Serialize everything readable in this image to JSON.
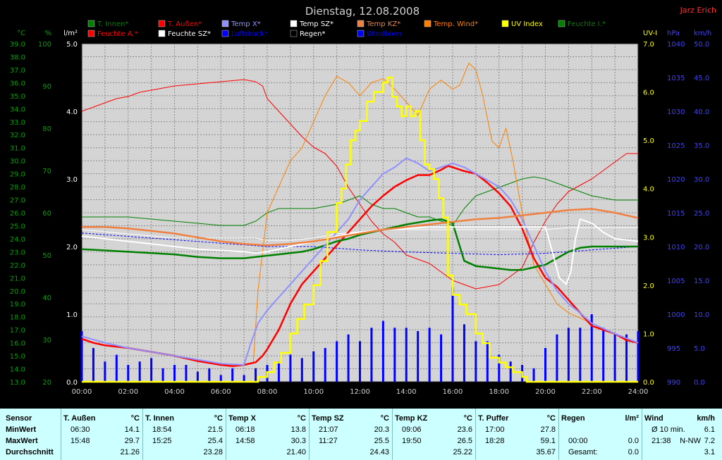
{
  "title": "Dienstag, 12.08.2008",
  "author": "Jarz Erich",
  "colors": {
    "background": "#000000",
    "plot": "#d4d4d4",
    "grid": "#808080",
    "stats_bg": "#ccffff"
  },
  "legend": [
    {
      "name": "T. Innen*",
      "color": "#008000"
    },
    {
      "name": "T. Außen*",
      "color": "#ff0000"
    },
    {
      "name": "Temp X*",
      "color": "#9090ff"
    },
    {
      "name": "Temp SZ*",
      "color": "#ffffff"
    },
    {
      "name": "Temp KZ*",
      "color": "#f08040"
    },
    {
      "name": "Temp. Wind*",
      "color": "#ff8000"
    },
    {
      "name": "UV Index",
      "color": "#ffff00"
    },
    {
      "name": "Feuchte I.*",
      "color": "#008000"
    },
    {
      "name": "Feuchte A.*",
      "color": "#ff0000"
    },
    {
      "name": "Feuchte SZ*",
      "color": "#ffffff"
    },
    {
      "name": "Luftdruck*",
      "color": "#0000ff"
    },
    {
      "name": "Regen*",
      "color": "#000000"
    },
    {
      "name": "Windböen",
      "color": "#0000ff"
    }
  ],
  "axes": {
    "temp": {
      "unit": "°C",
      "min": 13,
      "max": 39,
      "color": "#00a000"
    },
    "hum": {
      "unit": "%",
      "min": 20,
      "max": 100,
      "color": "#00a000"
    },
    "rain": {
      "unit": "l/m²",
      "min": 0,
      "max": 5,
      "color": "#ffffff"
    },
    "uv": {
      "unit": "UV-I",
      "min": 0,
      "max": 7,
      "color": "#ffff00"
    },
    "press": {
      "unit": "hPa",
      "min": 990,
      "max": 1040,
      "color": "#4040ff"
    },
    "wind": {
      "unit": "km/h",
      "min": 0,
      "max": 50,
      "color": "#4040ff"
    }
  },
  "x_ticks": [
    "00:00",
    "02:00",
    "04:00",
    "06:00",
    "08:00",
    "10:00",
    "12:00",
    "14:00",
    "16:00",
    "18:00",
    "20:00",
    "22:00",
    "24:00"
  ],
  "chart_data": {
    "type": "line",
    "title": "Dienstag, 12.08.2008",
    "x_unit": "hours",
    "xlim": [
      0,
      24
    ],
    "series": [
      {
        "name": "T. Außen*",
        "axis": "temp",
        "color": "#ff0000",
        "width": 2.5,
        "x": [
          0,
          0.5,
          1,
          2,
          3,
          4,
          5,
          6,
          6.5,
          7,
          7.5,
          7.8,
          8,
          8.5,
          9,
          9.5,
          10,
          10.5,
          11,
          11.5,
          12,
          12.5,
          13,
          13.5,
          14,
          14.5,
          15,
          15.5,
          15.8,
          16,
          16.5,
          17,
          17.5,
          18,
          18.5,
          19,
          19.5,
          20,
          20.5,
          21,
          21.5,
          22,
          22.5,
          23,
          23.5,
          24
        ],
        "y": [
          16.3,
          16,
          15.8,
          15.6,
          15.3,
          15,
          14.6,
          14.3,
          14.2,
          14.3,
          14.5,
          15,
          15.5,
          17,
          19,
          20.5,
          21.5,
          22.5,
          23.5,
          24.5,
          25.5,
          26.5,
          27.3,
          28,
          28.5,
          28.9,
          28.9,
          29.3,
          29.6,
          29.5,
          29.2,
          29,
          28.3,
          27.5,
          26.5,
          24.8,
          22.5,
          21,
          20.3,
          19.3,
          18.3,
          17.3,
          17,
          16.7,
          16.2,
          16
        ]
      },
      {
        "name": "T. Innen*",
        "axis": "temp",
        "color": "#008000",
        "width": 2.5,
        "x": [
          0,
          1,
          2,
          3,
          4,
          5,
          6,
          7,
          7.5,
          8,
          8.5,
          9,
          9.5,
          10,
          10.5,
          11,
          11.5,
          12,
          13,
          14,
          15,
          15.5,
          16,
          16.5,
          17,
          17.5,
          18,
          18.5,
          19,
          19.5,
          20,
          20.5,
          21,
          21.5,
          22,
          23,
          24
        ],
        "y": [
          23.2,
          23.1,
          23,
          22.9,
          22.8,
          22.6,
          22.5,
          22.5,
          22.6,
          22.7,
          22.8,
          22.9,
          23,
          23.2,
          23.5,
          23.8,
          24,
          24.3,
          24.7,
          25.1,
          25.4,
          25.5,
          25.2,
          22.3,
          21.9,
          21.8,
          21.7,
          21.6,
          21.6,
          21.8,
          22,
          22.5,
          23,
          23.3,
          23.4,
          23.4,
          23.4
        ]
      },
      {
        "name": "Temp X*",
        "axis": "temp",
        "color": "#9090ff",
        "width": 2,
        "x": [
          0,
          1,
          2,
          3,
          4,
          5,
          6,
          7,
          7.3,
          7.6,
          8,
          8.5,
          9,
          9.5,
          10,
          10.5,
          11,
          11.5,
          12,
          12.5,
          13,
          13.5,
          14,
          14.5,
          15,
          15.5,
          16,
          16.5,
          17,
          17.5,
          18,
          18.5,
          19,
          19.5,
          20,
          20.5,
          21,
          21.5,
          22,
          23,
          24
        ],
        "y": [
          16.5,
          16,
          15.6,
          15.3,
          15,
          14.7,
          14.4,
          14.3,
          16,
          17.5,
          18.5,
          19.5,
          20.5,
          21.5,
          22.5,
          23.5,
          24.5,
          25.5,
          27,
          28,
          29,
          29.5,
          30.2,
          29.8,
          29.2,
          29.5,
          29.8,
          29.5,
          29,
          28.5,
          28,
          27,
          25.5,
          23.5,
          21.5,
          20,
          19,
          18.3,
          17.5,
          16.7,
          16
        ]
      },
      {
        "name": "Temp SZ*",
        "axis": "temp",
        "color": "#ffffff",
        "width": 2,
        "x": [
          0,
          1,
          2,
          3,
          4,
          5,
          6,
          7,
          7.5,
          8,
          8.5,
          9,
          9.5,
          10,
          11,
          12,
          13,
          14,
          15,
          16,
          17,
          18,
          19,
          19.5,
          20,
          20.3,
          20.6,
          20.9,
          21.1,
          21.3,
          21.5,
          22,
          22.5,
          23,
          24
        ],
        "y": [
          24.2,
          24,
          23.8,
          23.6,
          23.4,
          23.2,
          23.1,
          23,
          22.9,
          23,
          23.2,
          23.4,
          23.6,
          23.8,
          24.2,
          24.5,
          24.7,
          24.8,
          24.9,
          24.9,
          24.9,
          24.9,
          24.9,
          24.9,
          24.9,
          23,
          21,
          20.5,
          21.5,
          24,
          25.5,
          25.2,
          24.5,
          24,
          23.8
        ]
      },
      {
        "name": "Temp KZ*",
        "axis": "temp",
        "color": "#f08040",
        "width": 2.5,
        "x": [
          0,
          1,
          2,
          3,
          4,
          5,
          6,
          7,
          8,
          9,
          10,
          11,
          12,
          13,
          14,
          15,
          16,
          17,
          18,
          19,
          20,
          21,
          22,
          23,
          24
        ],
        "y": [
          24.9,
          24.9,
          24.8,
          24.6,
          24.4,
          24.1,
          23.8,
          23.6,
          23.5,
          23.6,
          23.8,
          24.1,
          24.4,
          24.7,
          24.9,
          25.1,
          25.3,
          25.5,
          25.6,
          25.8,
          26,
          26.2,
          26.3,
          26,
          25.6
        ]
      }
    ],
    "other_series": [
      {
        "name": "Feuchte A.*",
        "axis": "hum",
        "color": "#ff0000",
        "width": 1,
        "x": [
          0,
          0.5,
          1,
          1.5,
          2,
          2.5,
          3,
          4,
          5,
          6,
          7,
          7.5,
          7.8,
          8,
          8.5,
          9,
          9.5,
          10,
          10.5,
          11,
          11.5,
          12,
          12.5,
          13,
          13.5,
          14,
          14.5,
          15,
          15.5,
          16,
          16.5,
          17,
          17.5,
          18,
          18.5,
          19,
          19.5,
          20,
          20.5,
          21,
          21.5,
          22,
          22.5,
          23,
          23.5,
          24
        ],
        "y": [
          84,
          85,
          86,
          87,
          87.5,
          88.5,
          89,
          90,
          90.5,
          91,
          91.5,
          91,
          90,
          87,
          84,
          81,
          78,
          75.5,
          74,
          71,
          66,
          62,
          58,
          55,
          53,
          50,
          49,
          48,
          46,
          44,
          43,
          42,
          42.5,
          43,
          45,
          47,
          53,
          58,
          62,
          65,
          66.5,
          68,
          70,
          72,
          74,
          74
        ]
      },
      {
        "name": "Feuchte I.*",
        "axis": "hum",
        "color": "#008000",
        "width": 1,
        "x": [
          0,
          1,
          2,
          3,
          4,
          5,
          6,
          7,
          7.5,
          8,
          8.5,
          9,
          10,
          11,
          11.5,
          12,
          12.5,
          13,
          13.5,
          14,
          14.5,
          15,
          15.5,
          16,
          16.5,
          17,
          17.5,
          18,
          18.5,
          19,
          19.5,
          20,
          20.5,
          21,
          21.5,
          22,
          23,
          24
        ],
        "y": [
          59,
          59,
          59,
          58.5,
          58,
          57.5,
          57,
          57,
          58,
          60,
          61,
          61,
          61,
          62,
          63,
          64,
          62,
          61,
          61,
          60,
          59,
          59,
          58,
          57,
          61,
          64,
          65,
          66,
          67,
          68,
          68.5,
          68,
          67,
          66,
          65,
          64,
          63,
          63
        ]
      },
      {
        "name": "Feuchte SZ*",
        "axis": "hum",
        "color": "#ffffff",
        "width": 1,
        "x": [
          0,
          1,
          2,
          3,
          4,
          5,
          6,
          7,
          7.5,
          8,
          8.5,
          9,
          10,
          11,
          12,
          13,
          14,
          15,
          16,
          17,
          18,
          19,
          20,
          21,
          22,
          23,
          24
        ],
        "y": [
          56,
          55.5,
          55,
          54.5,
          54,
          54,
          54,
          54,
          54,
          53.5,
          53.5,
          53.5,
          54,
          55,
          55.5,
          56,
          56,
          56,
          56,
          56,
          56,
          56,
          56,
          56.5,
          56.5,
          56.5,
          56.5
        ]
      },
      {
        "name": "Temp. Wind*",
        "axis": "temp",
        "color": "#ff8000",
        "width": 1,
        "x": [
          0,
          1,
          2,
          3,
          4,
          5,
          6,
          7,
          7.4,
          7.6,
          8,
          8.5,
          9,
          9.5,
          10,
          10.5,
          11,
          11.5,
          12,
          12.5,
          13,
          13.5,
          14,
          14.5,
          15,
          15.5,
          16,
          16.3,
          16.7,
          17,
          17.3,
          17.7,
          18,
          18.3,
          18.6,
          19,
          19.5,
          20,
          20.5,
          21,
          22,
          23,
          24
        ],
        "y": [
          16.5,
          16,
          15.6,
          15.3,
          15,
          14.7,
          14.4,
          14.3,
          14.5,
          20,
          26,
          28,
          30,
          31,
          33,
          35,
          36.5,
          36,
          35,
          36,
          36.3,
          35.5,
          34.5,
          33.5,
          35.5,
          36.2,
          35.5,
          35.8,
          37.5,
          37,
          35,
          31.5,
          31,
          32.5,
          30,
          26,
          22,
          20.5,
          19,
          18.3,
          17.5,
          16.7,
          16
        ]
      },
      {
        "name": "Luftdruck*",
        "axis": "press",
        "color": "#0000ff",
        "width": 1,
        "dash": true,
        "x": [
          0,
          2,
          4,
          6,
          8,
          10,
          12,
          14,
          16,
          18,
          20,
          22,
          24
        ],
        "y": [
          1012,
          1011.5,
          1011,
          1010.5,
          1010,
          1010,
          1009.5,
          1009.2,
          1009,
          1008.8,
          1009,
          1009.5,
          1010
        ]
      }
    ],
    "uv_index": {
      "name": "UV Index",
      "axis": "uv",
      "color": "#ffff00",
      "width": 2.5,
      "x": [
        0,
        7.5,
        7.6,
        8,
        8.3,
        8.6,
        9,
        9.3,
        9.6,
        10,
        10.3,
        10.6,
        11,
        11.2,
        11.4,
        11.6,
        11.8,
        12,
        12.3,
        12.6,
        12.8,
        13,
        13.2,
        13.4,
        13.6,
        13.8,
        14,
        14.2,
        14.4,
        14.6,
        14.8,
        15,
        15.2,
        15.4,
        15.6,
        15.8,
        16,
        16.3,
        16.6,
        17,
        17.3,
        17.6,
        18,
        18.3,
        18.6,
        19,
        19.2,
        24
      ],
      "y": [
        0,
        0,
        0.1,
        0.2,
        0.4,
        0.6,
        1,
        1.3,
        1.6,
        2,
        2.5,
        3.1,
        3.7,
        4,
        4.5,
        5,
        5.2,
        5.4,
        5.8,
        6,
        6,
        6.2,
        6.3,
        5.9,
        5.7,
        5.5,
        5.7,
        5.5,
        5.6,
        5,
        4.5,
        4.4,
        4.2,
        3.8,
        3.4,
        2.2,
        1.8,
        1.6,
        1.4,
        1,
        0.8,
        0.5,
        0.4,
        0.3,
        0.2,
        0.1,
        0,
        0
      ]
    },
    "wind_gusts": {
      "name": "Windböen",
      "axis": "wind",
      "color": "#0000ff",
      "x": [
        0,
        0.5,
        1,
        1.5,
        2,
        2.5,
        3,
        3.5,
        4,
        4.5,
        5,
        5.5,
        6,
        6.5,
        7,
        7.5,
        8,
        8.5,
        9,
        9.5,
        10,
        10.5,
        11,
        11.5,
        12,
        12.5,
        13,
        13.5,
        14,
        14.5,
        15,
        15.5,
        16,
        16.5,
        17,
        17.5,
        18,
        18.5,
        19,
        19.5,
        20,
        20.5,
        21,
        21.5,
        22,
        22.5,
        23,
        23.5,
        24
      ],
      "y": [
        7.5,
        5,
        3,
        4,
        2.5,
        3,
        3.5,
        2,
        2.5,
        2.5,
        1.5,
        2,
        1,
        2,
        1,
        2,
        2.5,
        3,
        4,
        3.5,
        4.5,
        5,
        6,
        7,
        6,
        8,
        9,
        8,
        8,
        7.5,
        8,
        7,
        14,
        8.5,
        6,
        6,
        4,
        3,
        2.5,
        2,
        5,
        7,
        8,
        8,
        10,
        8,
        7,
        7,
        7.5
      ]
    }
  },
  "stats": {
    "row_labels": [
      "Sensor",
      "MinWert",
      "MaxWert",
      "Durchschnitt"
    ],
    "columns": [
      {
        "title": "T. Außen",
        "unit": "°C",
        "min_time": "06:30",
        "min": "14.1",
        "max_time": "15:48",
        "max": "29.7",
        "avg": "21.26"
      },
      {
        "title": "T. Innen",
        "unit": "°C",
        "min_time": "18:54",
        "min": "21.5",
        "max_time": "15:25",
        "max": "25.4",
        "avg": "23.28"
      },
      {
        "title": "Temp X",
        "unit": "°C",
        "min_time": "06:18",
        "min": "13.8",
        "max_time": "14:58",
        "max": "30.3",
        "avg": "21.40"
      },
      {
        "title": "Temp SZ",
        "unit": "°C",
        "min_time": "21:07",
        "min": "20.3",
        "max_time": "11:27",
        "max": "25.5",
        "avg": "24.43"
      },
      {
        "title": "Temp KZ",
        "unit": "°C",
        "min_time": "09:06",
        "min": "23.6",
        "max_time": "19:50",
        "max": "26.5",
        "avg": "25.22"
      },
      {
        "title": "T. Puffer",
        "unit": "°C",
        "min_time": "17:00",
        "min": "27.8",
        "max_time": "18:28",
        "max": "59.1",
        "avg": "35.67"
      },
      {
        "title": "Regen",
        "unit": "l/m²",
        "min_time": "",
        "min": "",
        "max_time": "00:00",
        "max": "0.0",
        "avg_label": "Gesamt:",
        "avg": "0.0"
      },
      {
        "title": "Wind",
        "unit": "km/h",
        "min_time": "Ø 10 min.",
        "min": "6.1",
        "max_time": "21:38",
        "max_dir": "N-NW",
        "max": "7.2",
        "avg": "3.1"
      }
    ]
  }
}
